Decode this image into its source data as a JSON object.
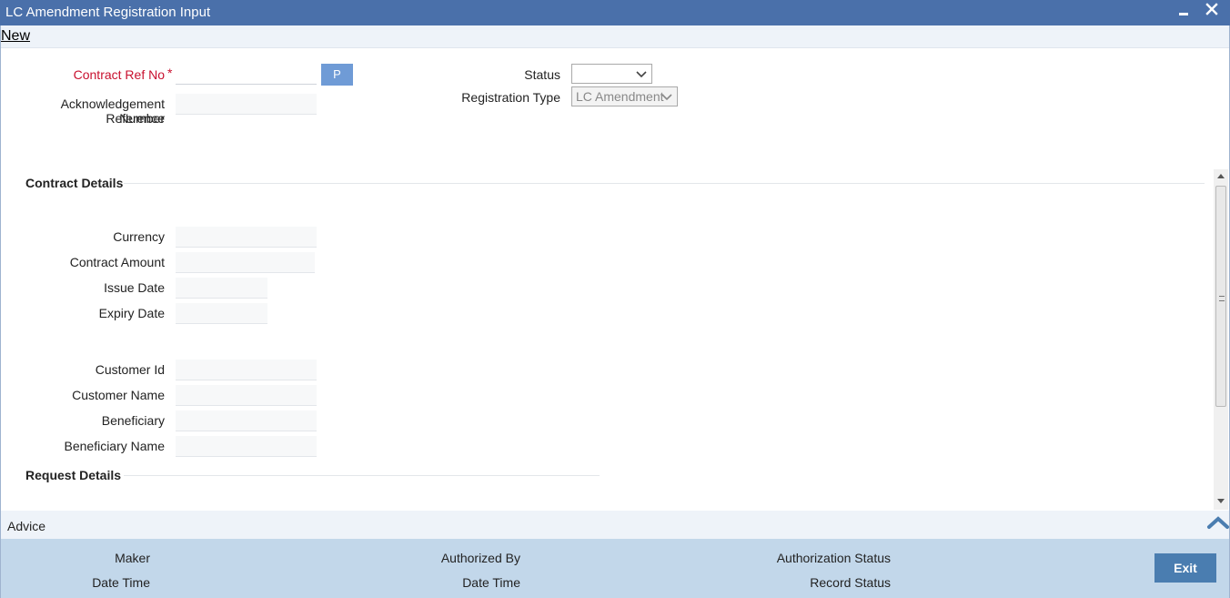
{
  "window": {
    "title": "LC Amendment Registration Input"
  },
  "menu": {
    "new_label": "New"
  },
  "header": {
    "contract_ref_label": "Contract Ref No",
    "required_mark": "*",
    "p_button_label": "P",
    "ack_ref_label_line1": "Acknowledgement Reference",
    "ack_ref_label_line2": "Number",
    "status_label": "Status",
    "status_value": "",
    "registration_type_label": "Registration Type",
    "registration_type_value": "LC Amendment"
  },
  "contract_details": {
    "section_title": "Contract Details",
    "currency_label": "Currency",
    "contract_amount_label": "Contract Amount",
    "issue_date_label": "Issue Date",
    "expiry_date_label": "Expiry Date",
    "customer_id_label": "Customer Id",
    "customer_name_label": "Customer Name",
    "beneficiary_label": "Beneficiary",
    "beneficiary_name_label": "Beneficiary Name"
  },
  "request_details": {
    "section_title": "Request Details"
  },
  "advice": {
    "label": "Advice"
  },
  "footer": {
    "maker_label": "Maker",
    "maker_datetime_label": "Date Time",
    "authorized_by_label": "Authorized By",
    "auth_datetime_label": "Date Time",
    "authorization_status_label": "Authorization Status",
    "record_status_label": "Record Status",
    "exit_label": "Exit"
  }
}
